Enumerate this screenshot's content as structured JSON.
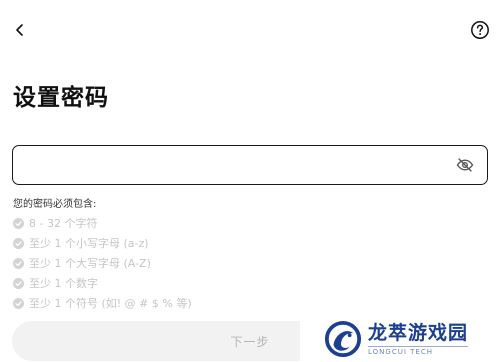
{
  "header": {
    "back_icon": "chevron-left-icon",
    "help_icon": "question-circle-icon"
  },
  "page": {
    "title": "设置密码"
  },
  "password_field": {
    "value": "",
    "placeholder": "",
    "visibility_icon": "eye-off-icon"
  },
  "requirements": {
    "title": "您的密码必须包含:",
    "items": [
      {
        "label": "8 - 32 个字符"
      },
      {
        "label": "至少 1 个小写字母 (a-z)"
      },
      {
        "label": "至少 1 个大写字母 (A-Z)"
      },
      {
        "label": "至少 1 个数字"
      },
      {
        "label": "至少 1 个符号 (如! @ # $ % 等)"
      }
    ]
  },
  "next_button": {
    "label": "下一步"
  },
  "watermark": {
    "title": "龙萃游戏园",
    "subtitle": "LONGCUI TECH"
  },
  "colors": {
    "text_primary": "#111111",
    "text_muted": "#c6c6c6",
    "border": "#1a1a1a",
    "button_disabled_bg": "#f2f2f2",
    "watermark_blue": "#1c3f8f"
  }
}
